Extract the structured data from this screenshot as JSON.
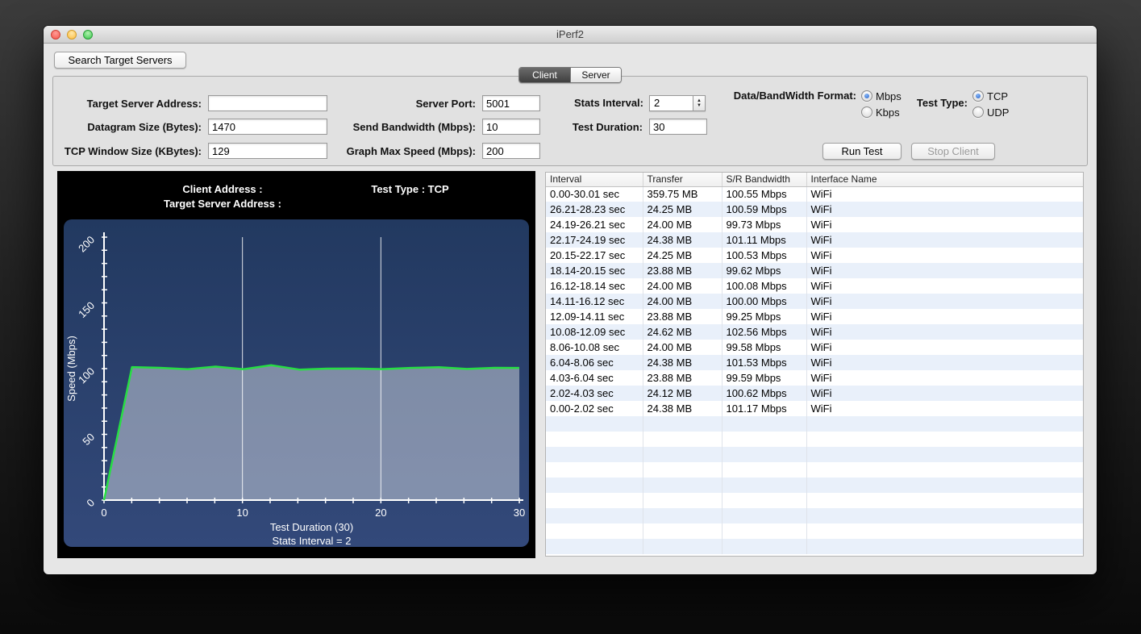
{
  "window": {
    "title": "iPerf2"
  },
  "toolbar": {
    "search_button": "Search Target Servers"
  },
  "tabs": {
    "client": "Client",
    "server": "Server"
  },
  "icons": {
    "stepper_up": "▲",
    "stepper_down": "▼"
  },
  "form": {
    "target_server_address": {
      "label": "Target Server Address:",
      "value": ""
    },
    "datagram_size": {
      "label": "Datagram Size (Bytes):",
      "value": "1470"
    },
    "tcp_window_size": {
      "label": "TCP Window Size (KBytes):",
      "value": "129"
    },
    "server_port": {
      "label": "Server Port:",
      "value": "5001"
    },
    "send_bandwidth": {
      "label": "Send Bandwidth (Mbps):",
      "value": "10"
    },
    "graph_max_speed": {
      "label": "Graph Max Speed (Mbps):",
      "value": "200"
    },
    "stats_interval": {
      "label": "Stats Interval:",
      "value": "2"
    },
    "test_duration": {
      "label": "Test Duration:",
      "value": "30"
    },
    "format": {
      "label": "Data/BandWidth Format:",
      "options": [
        "Mbps",
        "Kbps"
      ],
      "selected": "Mbps"
    },
    "test_type": {
      "label": "Test Type:",
      "options": [
        "TCP",
        "UDP"
      ],
      "selected": "TCP"
    },
    "run_button": "Run Test",
    "stop_button": "Stop Client"
  },
  "chart_data": {
    "type": "line",
    "header": {
      "client_address_label": "Client Address :",
      "target_server_label": "Target Server Address :",
      "test_type_label": "Test Type : TCP"
    },
    "ylabel": "Speed (Mbps)",
    "xlabel": "Test Duration (30)",
    "sub_xlabel": "Stats Interval = 2",
    "xlim": [
      0,
      30
    ],
    "ylim": [
      0,
      200
    ],
    "xticks": [
      0,
      10,
      20,
      30
    ],
    "yticks": [
      0,
      50,
      100,
      150,
      200
    ],
    "grid": "vertical gridlines at x=10 and x=20; white axes with minor ticks",
    "colors": {
      "line": "#27de43",
      "fill": "rgba(255,255,255,0.40)",
      "background_top": "#223960",
      "background_bottom": "#33497a"
    },
    "series": [
      {
        "name": "speed",
        "color": "#27de43",
        "x": [
          0,
          2.02,
          4.03,
          6.04,
          8.06,
          10.08,
          12.09,
          14.11,
          16.12,
          18.14,
          20.15,
          22.17,
          24.19,
          26.21,
          28.23,
          30.01
        ],
        "y": [
          0,
          101.17,
          100.62,
          99.59,
          101.53,
          99.58,
          102.56,
          99.25,
          100.0,
          100.08,
          99.62,
          100.53,
          101.11,
          99.73,
          100.59,
          100.55
        ]
      }
    ]
  },
  "table": {
    "headers": [
      "Interval",
      "Transfer",
      "S/R Bandwidth",
      "Interface Name"
    ],
    "rows": [
      [
        "0.00-30.01 sec",
        "359.75 MB",
        "100.55 Mbps",
        "WiFi"
      ],
      [
        "26.21-28.23 sec",
        "24.25 MB",
        "100.59 Mbps",
        "WiFi"
      ],
      [
        "24.19-26.21 sec",
        "24.00 MB",
        "99.73 Mbps",
        "WiFi"
      ],
      [
        "22.17-24.19 sec",
        "24.38 MB",
        "101.11 Mbps",
        "WiFi"
      ],
      [
        "20.15-22.17 sec",
        "24.25 MB",
        "100.53 Mbps",
        "WiFi"
      ],
      [
        "18.14-20.15 sec",
        "23.88 MB",
        "99.62 Mbps",
        "WiFi"
      ],
      [
        "16.12-18.14 sec",
        "24.00 MB",
        "100.08 Mbps",
        "WiFi"
      ],
      [
        "14.11-16.12 sec",
        "24.00 MB",
        "100.00 Mbps",
        "WiFi"
      ],
      [
        "12.09-14.11 sec",
        "23.88 MB",
        "99.25 Mbps",
        "WiFi"
      ],
      [
        "10.08-12.09 sec",
        "24.62 MB",
        "102.56 Mbps",
        "WiFi"
      ],
      [
        "8.06-10.08 sec",
        "24.00 MB",
        "99.58 Mbps",
        "WiFi"
      ],
      [
        "6.04-8.06 sec",
        "24.38 MB",
        "101.53 Mbps",
        "WiFi"
      ],
      [
        "4.03-6.04 sec",
        "23.88 MB",
        "99.59 Mbps",
        "WiFi"
      ],
      [
        "2.02-4.03 sec",
        "24.12 MB",
        "100.62 Mbps",
        "WiFi"
      ],
      [
        "0.00-2.02 sec",
        "24.38 MB",
        "101.17 Mbps",
        "WiFi"
      ]
    ],
    "empty_row_count": 9
  }
}
